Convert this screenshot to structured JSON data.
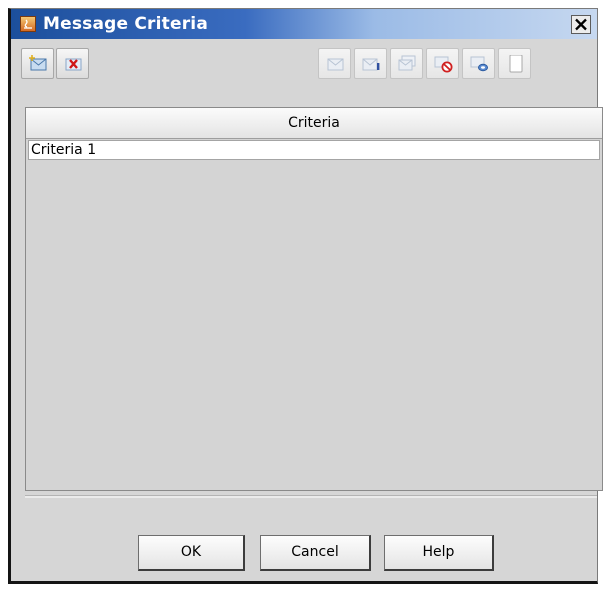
{
  "window": {
    "title": "Message Criteria",
    "close_glyph": "×"
  },
  "toolbar": {
    "left_buttons": [
      {
        "icon": "add-criteria-icon",
        "enabled": true
      },
      {
        "icon": "delete-criteria-icon",
        "enabled": true
      }
    ],
    "right_buttons": [
      {
        "icon": "message-icon",
        "enabled": false
      },
      {
        "icon": "message-info-icon",
        "enabled": false
      },
      {
        "icon": "message-copy-icon",
        "enabled": false
      },
      {
        "icon": "message-block-icon",
        "enabled": false
      },
      {
        "icon": "message-link-icon",
        "enabled": false
      },
      {
        "icon": "blank-page-icon",
        "enabled": false
      }
    ]
  },
  "table": {
    "column_header": "Criteria",
    "rows": [
      "Criteria 1"
    ]
  },
  "footer": {
    "ok_label": "OK",
    "cancel_label": "Cancel",
    "help_label": "Help"
  }
}
